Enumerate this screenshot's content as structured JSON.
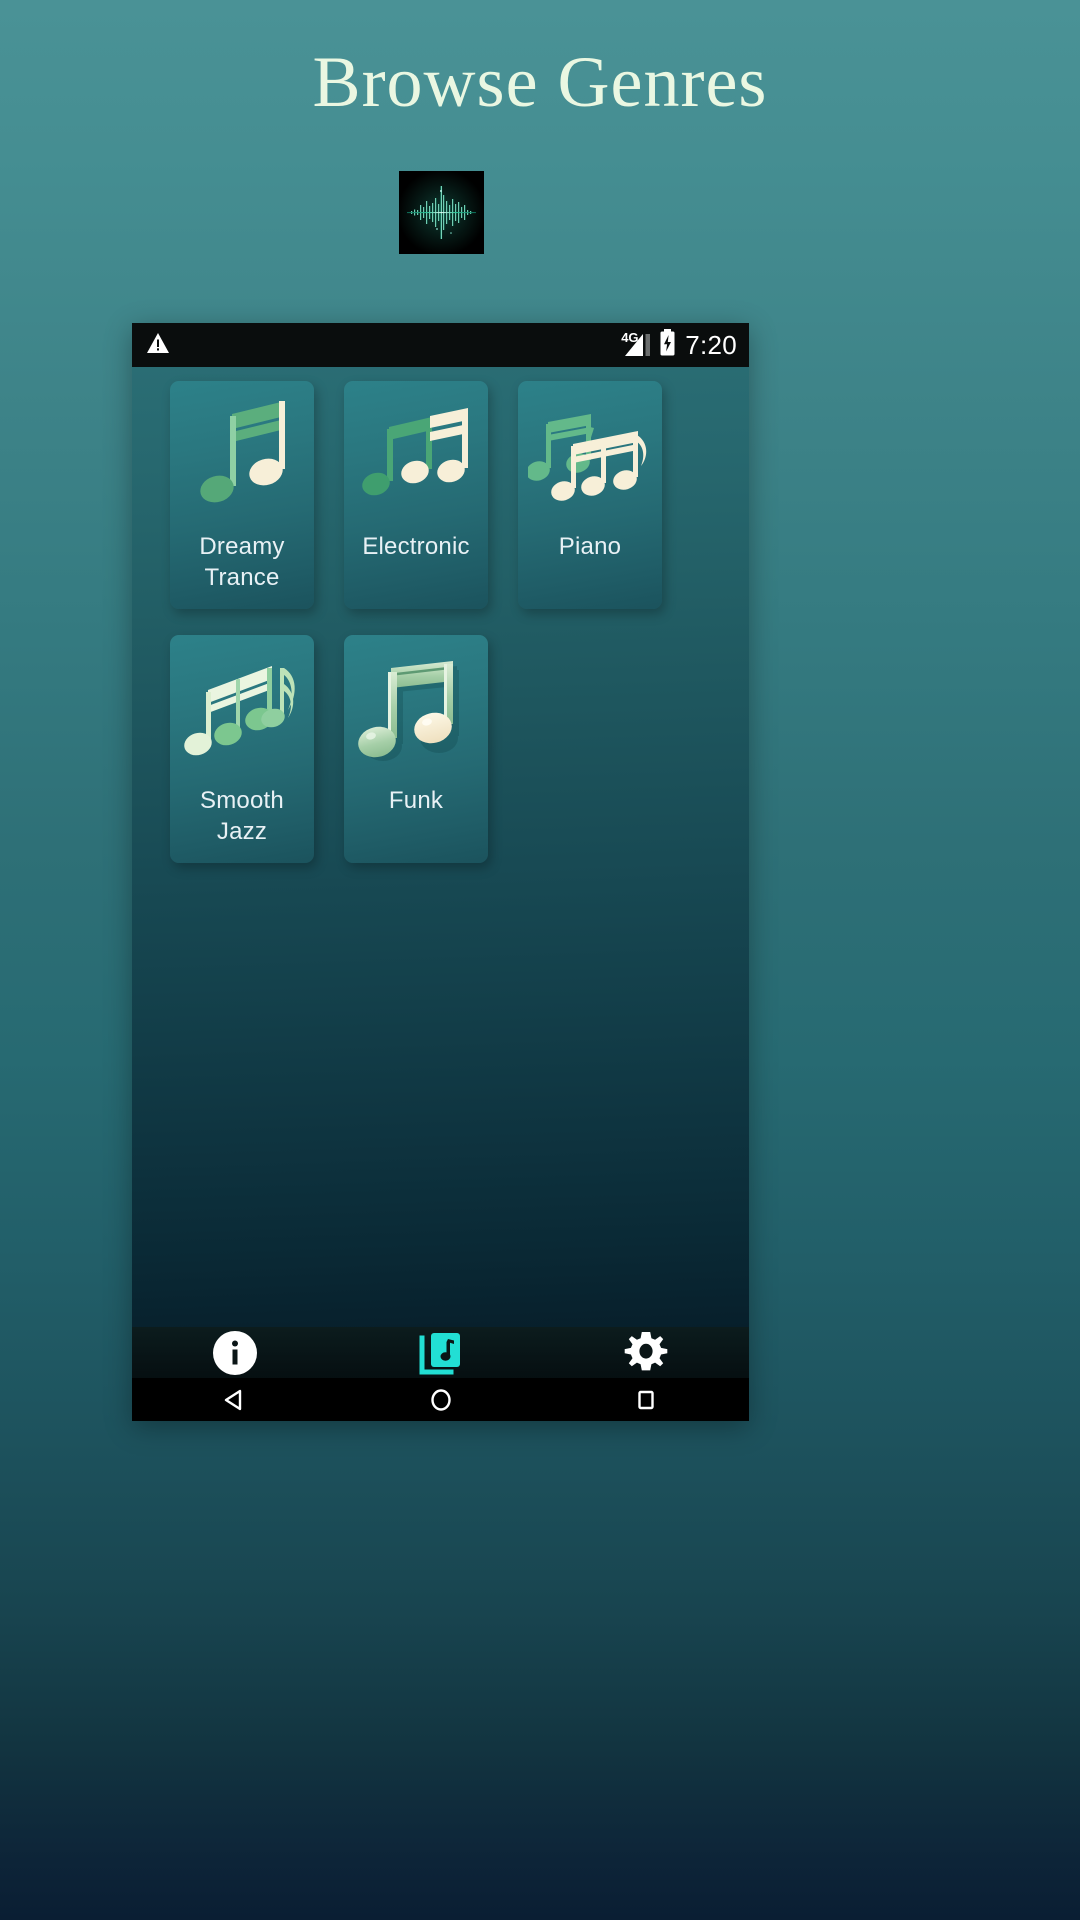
{
  "page": {
    "title": "Browse Genres",
    "app_icon_name": "audio-waveform-app-icon"
  },
  "colors": {
    "background_top": "#4a9296",
    "background_bottom": "#0a1e33",
    "card_top": "#2d8189",
    "card_bottom": "#1b535d",
    "accent_cyan": "#22dfd4",
    "label_text": "#e8f1f5",
    "title_text": "#eaf7e2",
    "note_green": "#68b583",
    "note_cream": "#f7efd8"
  },
  "statusbar": {
    "warning_icon": "warning-triangle-icon",
    "network_label": "4G",
    "signal_icon": "signal-bars-icon",
    "battery_icon": "battery-charging-icon",
    "time": "7:20"
  },
  "genres": [
    {
      "label": "Dreamy Trance",
      "art": "double-eighth-note"
    },
    {
      "label": "Electronic",
      "art": "two-note-pair"
    },
    {
      "label": "Piano",
      "art": "layered-note-cluster"
    },
    {
      "label": "Smooth Jazz",
      "art": "triple-note-group"
    },
    {
      "label": "Funk",
      "art": "glossy-beamed-note"
    }
  ],
  "tabbar": {
    "items": [
      {
        "name": "info",
        "icon": "info-circle-icon",
        "active": false
      },
      {
        "name": "library",
        "icon": "music-library-icon",
        "active": true
      },
      {
        "name": "settings",
        "icon": "gear-icon",
        "active": false
      }
    ]
  },
  "navbar": {
    "items": [
      {
        "name": "back",
        "icon": "back-triangle-icon"
      },
      {
        "name": "home",
        "icon": "home-circle-icon"
      },
      {
        "name": "recents",
        "icon": "recents-square-icon"
      }
    ]
  }
}
